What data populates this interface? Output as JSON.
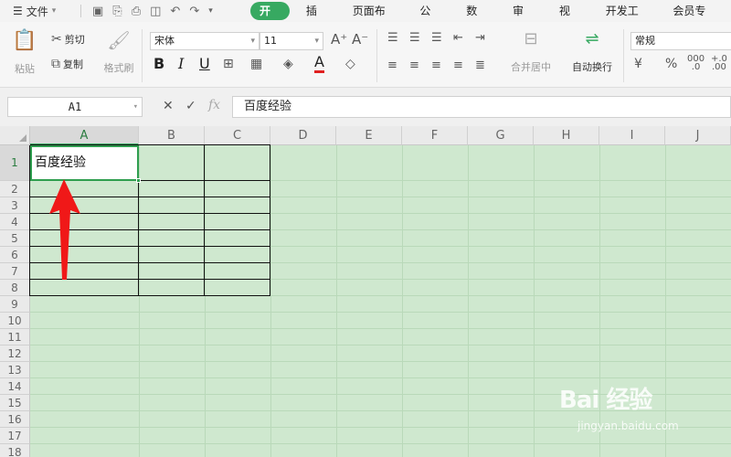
{
  "menubar": {
    "file_label": "文件",
    "tabs": [
      {
        "label": "开始",
        "active": true
      },
      {
        "label": "插入",
        "active": false
      },
      {
        "label": "页面布局",
        "active": false
      },
      {
        "label": "公式",
        "active": false
      },
      {
        "label": "数据",
        "active": false
      },
      {
        "label": "审阅",
        "active": false
      },
      {
        "label": "视图",
        "active": false
      },
      {
        "label": "开发工具",
        "active": false
      },
      {
        "label": "会员专享",
        "active": false
      }
    ]
  },
  "ribbon": {
    "paste_label": "粘贴",
    "cut_label": "剪切",
    "copy_label": "复制",
    "format_painter_label": "格式刷",
    "font_name": "宋体",
    "font_size": "11",
    "font_grow_icon": "A⁺",
    "font_shrink_icon": "A⁻",
    "bold_label": "B",
    "italic_label": "I",
    "underline_label": "U",
    "font_color_label": "A",
    "merge_center_label": "合并居中",
    "wrap_text_label": "自动换行",
    "number_format": "常规",
    "currency_label": "¥",
    "percent_label": "%",
    "accent_color": "#37a961",
    "font_color": "#e02020"
  },
  "formula_bar": {
    "cell_ref": "A1",
    "cancel_icon": "✕",
    "confirm_icon": "✓",
    "fx_label": "fx",
    "content": "百度经验"
  },
  "sheet": {
    "columns": [
      "A",
      "B",
      "C",
      "D",
      "E",
      "F",
      "G",
      "H",
      "I",
      "J"
    ],
    "rows": [
      "1",
      "2",
      "3",
      "4",
      "5",
      "6",
      "7",
      "8",
      "9",
      "10",
      "11",
      "12",
      "13",
      "14",
      "15",
      "16",
      "17",
      "18"
    ],
    "selected_cell": "A1",
    "a1_value": "百度经验",
    "background_color": "#cfe8cf"
  },
  "watermark": {
    "title": "Bai 经验",
    "subtitle": "jingyan.baidu.com"
  }
}
